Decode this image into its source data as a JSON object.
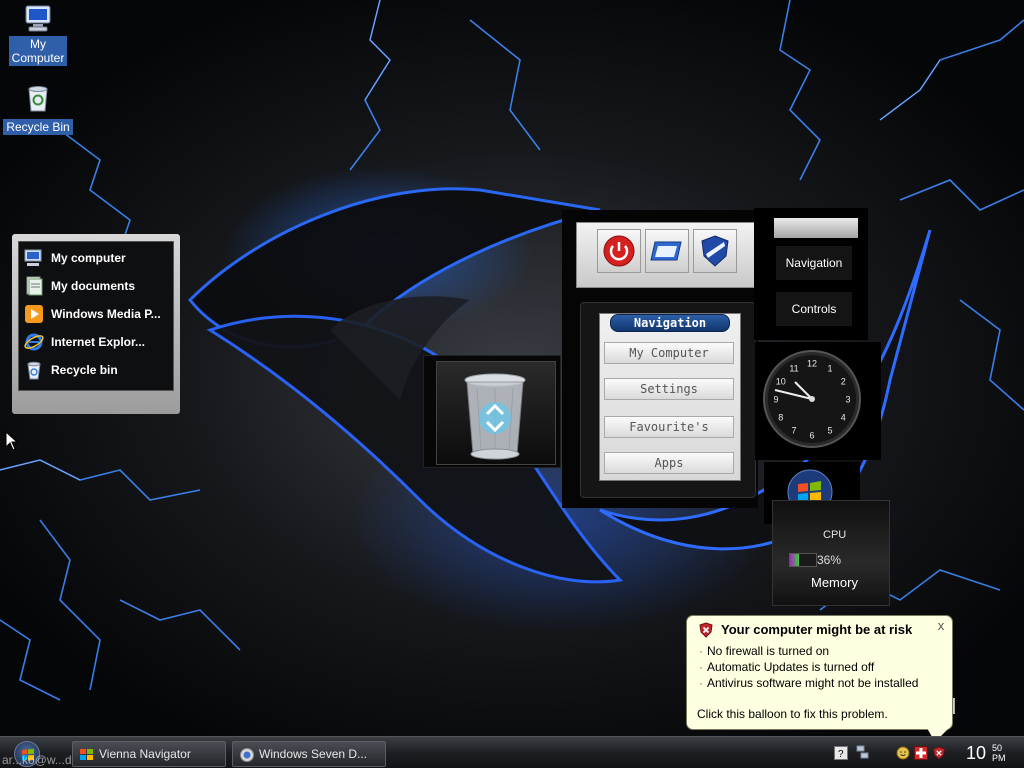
{
  "desktop": {
    "icons": [
      {
        "label": "My\nComputer",
        "icon": "my-computer-icon"
      },
      {
        "label": "Recycle Bin",
        "icon": "recycle-bin-icon"
      }
    ]
  },
  "quicklist": {
    "items": [
      {
        "label": "My computer",
        "icon": "computer-icon"
      },
      {
        "label": "My documents",
        "icon": "documents-icon"
      },
      {
        "label": "Windows Media P...",
        "icon": "media-player-icon"
      },
      {
        "label": "Internet Explor...",
        "icon": "internet-explorer-icon"
      },
      {
        "label": "Recycle bin",
        "icon": "recycle-bin-icon"
      }
    ]
  },
  "navigation_gadget": {
    "title": "Navigation",
    "buttons": [
      "My Computer",
      "Settings",
      "Favourite's",
      "Apps"
    ]
  },
  "side_panel": {
    "nav_label": "Navigation",
    "controls_label": "Controls"
  },
  "clock": {
    "numbers": [
      "12",
      "1",
      "2",
      "3",
      "4",
      "5",
      "6",
      "7",
      "8",
      "9",
      "10",
      "11"
    ]
  },
  "meter": {
    "cpu_label": "CPU",
    "cpu_percent_text": "36%",
    "cpu_fraction": 0.36,
    "memory_label": "Memory"
  },
  "brand_text": "al",
  "balloon": {
    "title": "Your computer might be at risk",
    "close": "x",
    "lines": [
      "No firewall is turned on",
      "Automatic Updates is turned off",
      "Antivirus software might not be installed"
    ],
    "footer": "Click this balloon to fix this problem."
  },
  "taskbar": {
    "tasks": [
      {
        "label": "Vienna Navigator"
      },
      {
        "label": "Windows Seven D..."
      }
    ],
    "watermark": "ar...ko@w...de",
    "time": "10",
    "time_minutes": "50",
    "ampm": "PM"
  },
  "colors": {
    "balloon_bg": "#ffffe1",
    "accent_blue": "#2f5fa8",
    "lightning": "#3f8bff"
  }
}
